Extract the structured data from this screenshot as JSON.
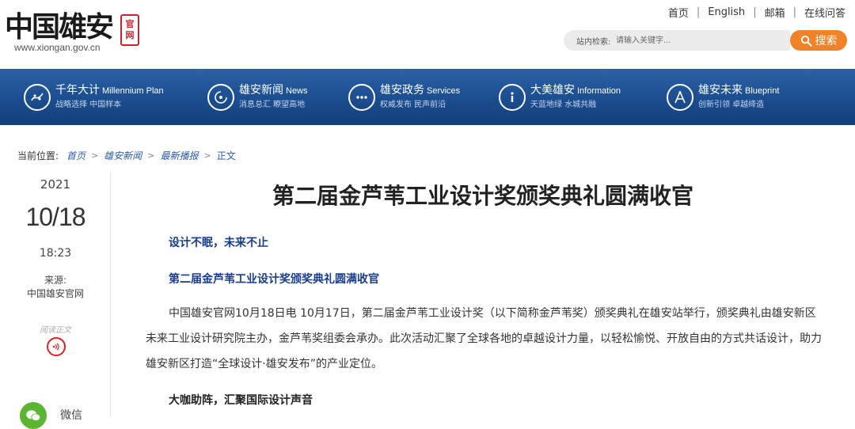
{
  "header": {
    "logo_text": "中国雄安",
    "logo_seal": "官网",
    "logo_url": "www.xiongan.gov.cn",
    "top_links": [
      "首页",
      "English",
      "邮箱",
      "在线问答"
    ],
    "search": {
      "label": "站内检索:",
      "placeholder": "请输入关键字...",
      "button_label": "搜索"
    }
  },
  "nav": {
    "items": [
      {
        "cn": "千年大计",
        "en": "Millennium Plan",
        "sub": "战略选择 中国样本",
        "icon": "millennium-icon"
      },
      {
        "cn": "雄安新闻",
        "en": "News",
        "sub": "消息总汇 瞭望高地",
        "icon": "news-icon"
      },
      {
        "cn": "雄安政务",
        "en": "Services",
        "sub": "权威发布 民声前沿",
        "icon": "services-icon"
      },
      {
        "cn": "大美雄安",
        "en": "Information",
        "sub": "天蓝地绿 水城共融",
        "icon": "info-icon"
      },
      {
        "cn": "雄安未来",
        "en": "Blueprint",
        "sub": "创新引领 卓越绛造",
        "icon": "blueprint-icon"
      }
    ]
  },
  "breadcrumb": {
    "label": "当前位置:",
    "items": [
      "首页",
      "雄安新闻",
      "最新播报"
    ],
    "current": "正文"
  },
  "meta": {
    "year": "2021",
    "date": "10/18",
    "time": "18:23",
    "source_label": "来源:",
    "source": "中国雄安官网",
    "read_label": "阅读正文",
    "share_wechat": "微信"
  },
  "article": {
    "title": "第二届金芦苇工业设计奖颁奖典礼圆满收官",
    "subheading_1": "设计不眠，未来不止",
    "subheading_2": "第二届金芦苇工业设计奖颁奖典礼圆满收官",
    "paragraph_1": "中国雄安官网10月18日电 10月17日，第二届金芦苇工业设计奖（以下简称金芦苇奖）颁奖典礼在雄安站举行，颁奖典礼由雄安新区未来工业设计研究院主办，金芦苇奖组委会承办。此次活动汇聚了全球各地的卓越设计力量，以轻松愉悦、开放自由的方式共话设计，助力雄安新区打造“全球设计·雄安发布”的产业定位。",
    "section_heading": "大咖助阵，汇聚国际设计声音"
  },
  "colors": {
    "nav_bg": "#1b4d8f",
    "search_button": "#f0822a",
    "subheading": "#183d8f",
    "link": "#2a5ba8",
    "seal": "#c0282d",
    "wechat": "#5cb531"
  }
}
